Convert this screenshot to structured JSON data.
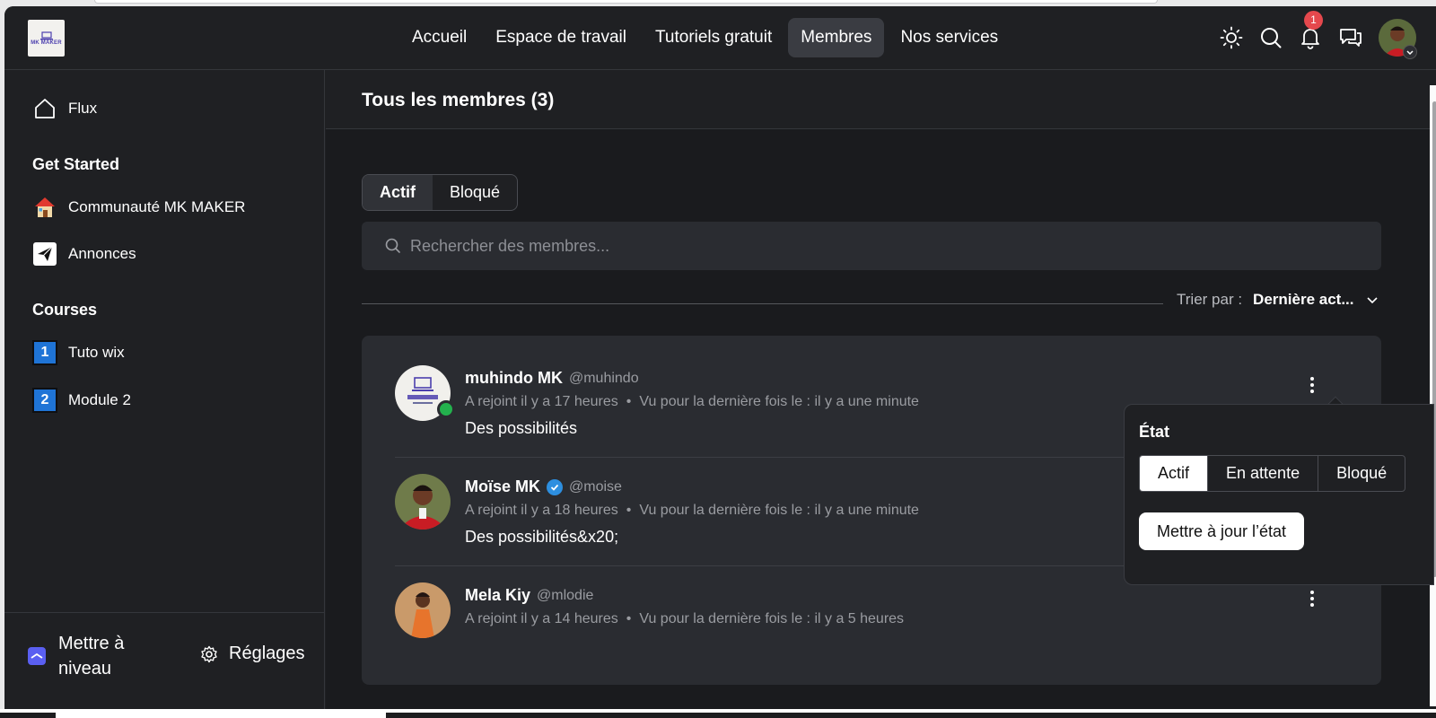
{
  "brand": {
    "logo_text": "MK MAKER"
  },
  "nav": {
    "items": [
      {
        "label": "Accueil"
      },
      {
        "label": "Espace de travail"
      },
      {
        "label": "Tutoriels gratuit"
      },
      {
        "label": "Membres",
        "active": true
      },
      {
        "label": "Nos services"
      }
    ]
  },
  "header": {
    "notification_count": "1"
  },
  "sidebar": {
    "feed": {
      "label": "Flux",
      "icon": "home-icon"
    },
    "sections": [
      {
        "title": "Get Started",
        "items": [
          {
            "label": "Communauté MK MAKER",
            "icon": "house-emoji-icon"
          },
          {
            "label": "Annonces",
            "icon": "paper-plane-icon"
          }
        ]
      },
      {
        "title": "Courses",
        "items": [
          {
            "label": "Tuto wix",
            "icon": "number-1-icon",
            "num": "1"
          },
          {
            "label": "Module 2",
            "icon": "number-2-icon",
            "num": "2"
          }
        ]
      }
    ],
    "upgrade_label": "Mettre à niveau",
    "settings_label": "Réglages"
  },
  "main": {
    "title": "Tous les membres (3)",
    "tabs": [
      {
        "label": "Actif",
        "active": true
      },
      {
        "label": "Bloqué"
      }
    ],
    "search_placeholder": "Rechercher des membres...",
    "sort_label": "Trier par :",
    "sort_value": "Dernière act..."
  },
  "members": [
    {
      "name": "muhindo MK",
      "handle": "@muhindo",
      "joined": "A rejoint il y a 17 heures",
      "last_seen": "Vu pour la dernière fois le : il y a une minute",
      "bio": "Des possibilités",
      "online": true,
      "verified": false
    },
    {
      "name": "Moïse MK",
      "handle": "@moise",
      "joined": "A rejoint il y a 18 heures",
      "last_seen": "Vu pour la dernière fois le : il y a une minute",
      "bio": "Des possibilités&x20;",
      "online": false,
      "verified": true
    },
    {
      "name": "Mela Kiy",
      "handle": "@mlodie",
      "joined": "A rejoint il y a 14 heures",
      "last_seen": "Vu pour la dernière fois le : il y a 5 heures",
      "bio": "",
      "online": false,
      "verified": false
    }
  ],
  "status_popover": {
    "title": "État",
    "options": [
      {
        "label": "Actif",
        "selected": true
      },
      {
        "label": "En attente"
      },
      {
        "label": "Bloqué"
      }
    ],
    "button": "Mettre à jour l’état"
  },
  "colors": {
    "accent_badge": "#e5484d",
    "online": "#23b14d",
    "verified": "#2d8fe0",
    "upgrade": "#5a5ff1"
  }
}
